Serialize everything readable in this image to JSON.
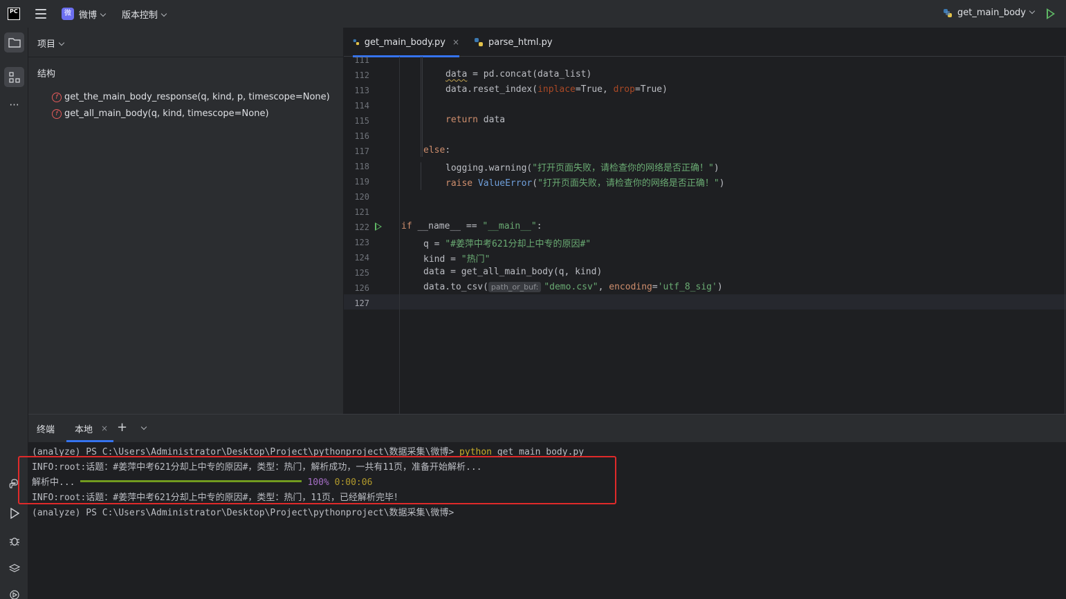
{
  "titlebar": {
    "app_logo_text": "PC",
    "project_badge": "微",
    "project_name": "微博",
    "vcs_label": "版本控制",
    "run_config": "get_main_body"
  },
  "toolstrip": {
    "icons": [
      "folder-icon",
      "structure-icon",
      "more-icon",
      "python-console-icon",
      "run-icon",
      "debug-icon",
      "layers-icon",
      "services-icon"
    ]
  },
  "sidepanel": {
    "title": "项目",
    "structure_title": "结构",
    "items": [
      {
        "icon_text": "f",
        "label": "get_the_main_body_response(q, kind, p, timescope=None)"
      },
      {
        "icon_text": "f",
        "label": "get_all_main_body(q, kind, timescope=None)"
      }
    ]
  },
  "editor": {
    "tabs": [
      {
        "label": "get_main_body.py",
        "close": "×"
      },
      {
        "label": "parse_html.py"
      }
    ],
    "line_numbers": [
      "111",
      "112",
      "113",
      "114",
      "115",
      "116",
      "117",
      "118",
      "119",
      "120",
      "121",
      "122",
      "123",
      "124",
      "125",
      "126",
      "127"
    ],
    "hint": "path_or_buf:",
    "code": {
      "l112_data": "data",
      "l112_rest": " = pd.concat(data_list)",
      "l113_a": "data.reset_index(",
      "l113_p1": "inplace",
      "l113_b": "=True, ",
      "l113_p2": "drop",
      "l113_c": "=True)",
      "l115_kw": "return",
      "l115_rest": " data",
      "l117_kw": "else",
      "l117_rest": ":",
      "l118_a": "logging.warning(",
      "l118_str": "\"打开页面失败，请检查你的网络是否正确！\"",
      "l118_b": ")",
      "l119_kw": "raise",
      "l119_cls": "ValueError",
      "l119_a": "(",
      "l119_str": "\"打开页面失败，请检查你的网络是否正确！\"",
      "l119_b": ")",
      "l122_kw": "if",
      "l122_a": " __name__ == ",
      "l122_str": "\"__main__\"",
      "l122_b": ":",
      "l123_a": "q = ",
      "l123_str": "\"#姜萍中考621分却上中专的原因#\"",
      "l124_a": "kind = ",
      "l124_str": "\"热门\"",
      "l125": "data = get_all_main_body(q, kind)",
      "l126_a": "data.to_csv(",
      "l126_str": "\"demo.csv\"",
      "l126_b": ", ",
      "l126_p": "encoding",
      "l126_c": "=",
      "l126_str2": "'utf_8_sig'",
      "l126_d": ")"
    }
  },
  "terminal": {
    "title": "终端",
    "tab_label": "本地",
    "tab_close": "×",
    "add": "+",
    "prompt1": "(analyze) PS C:\\Users\\Administrator\\Desktop\\Project\\pythonproject\\数据采集\\微博> ",
    "cmd_python": "python",
    "cmd_rest": " get_main_body.py",
    "info1": "INFO:root:话题：#姜萍中考621分却上中专的原因#，类型：热门，解析成功，一共有11页，准备开始解析...",
    "parsing": "解析中...",
    "progress": 1.0,
    "progress_pct": "100%",
    "progress_eta": "0:00:06",
    "info2": "INFO:root:话题：#姜萍中考621分却上中专的原因#，类型：热门，11页，已经解析完毕！",
    "prompt2": "(analyze) PS C:\\Users\\Administrator\\Desktop\\Project\\pythonproject\\数据采集\\微博>"
  },
  "colors": {
    "accent": "#3574f0",
    "run_green": "#5fb865",
    "highlight_red": "#e02a2a",
    "keyword": "#cf8e6d",
    "string": "#6aab73"
  }
}
